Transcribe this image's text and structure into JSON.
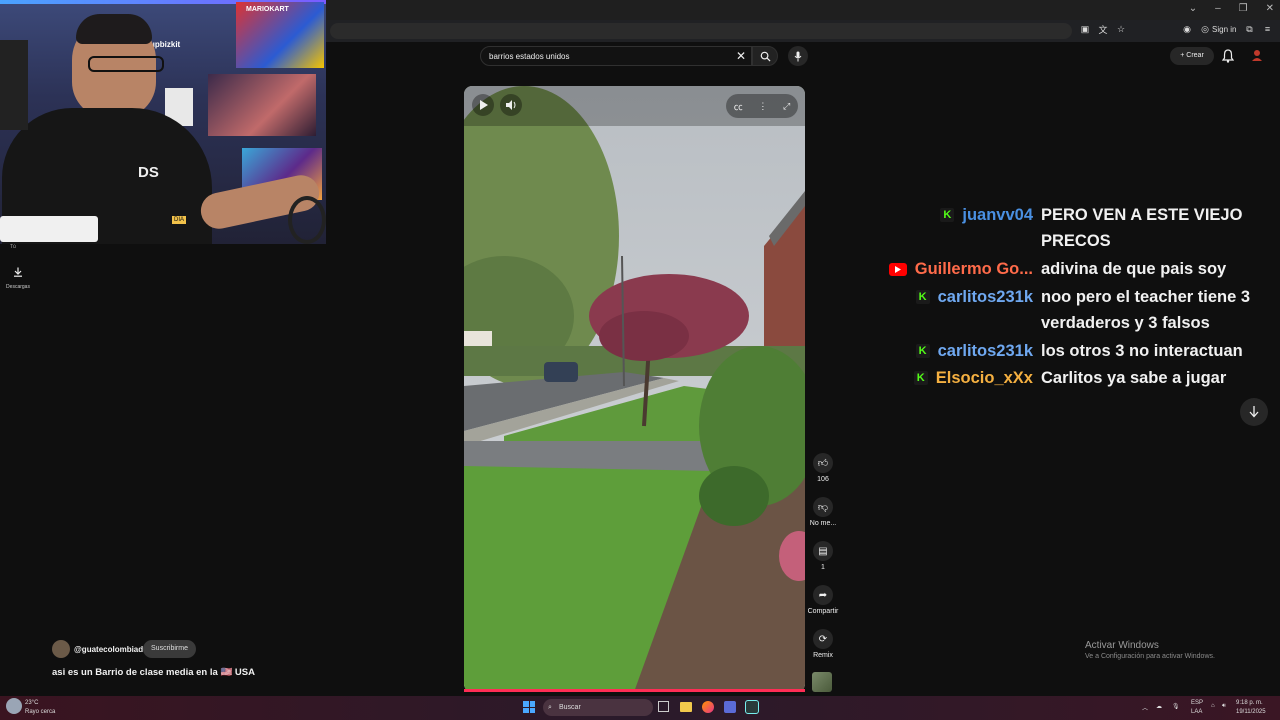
{
  "browser": {
    "tabbar_controls": [
      "⌄",
      "–",
      "❐",
      "✕"
    ],
    "sign_in_label": "Sign in"
  },
  "youtube_header": {
    "search_value": "barrios estados unidos",
    "create_label": "Crear"
  },
  "sidebar": {
    "partial_label": "Tú",
    "downloads_label": "Descargas"
  },
  "webcam": {
    "poster_text": "MARIOKART",
    "channel_handle_partial": "upbizkit",
    "shirt_logo": "DS",
    "sign_partial": "DIA"
  },
  "actions": {
    "like_count": "106",
    "dislike_label": "No me...",
    "comments_count": "1",
    "share_label": "Compartir",
    "remix_label": "Remix"
  },
  "chat": {
    "messages": [
      {
        "platform": "kick",
        "user": "juanvv04",
        "user_color": "#4a90e2",
        "text": "PERO VEN A ESTE VIEJO PRECOS"
      },
      {
        "platform": "youtube",
        "user": "Guillermo Go...",
        "user_color": "#ff6b4a",
        "text": "adivina de que pais soy"
      },
      {
        "platform": "kick",
        "user": "carlitos231k",
        "user_color": "#6fa8f0",
        "text": "noo pero el teacher tiene 3 verdaderos y 3 falsos"
      },
      {
        "platform": "kick",
        "user": "carlitos231k",
        "user_color": "#6fa8f0",
        "text": "los otros 3 no interactuan"
      },
      {
        "platform": "kick",
        "user": "Elsocio_xXx",
        "user_color": "#f5b041",
        "text": "Carlitos ya sabe a jugar"
      }
    ]
  },
  "channel": {
    "name": "@guatecolombiad",
    "subscribe_label": "Suscribirme",
    "video_title": "asi es un Barrio de clase media en la 🇺🇸 USA"
  },
  "windows_activation": {
    "title": "Activar Windows",
    "subtitle": "Ve a Configuración para activar Windows."
  },
  "taskbar": {
    "weather_temp": "23°C",
    "weather_desc": "Rayo cerca",
    "search_label": "Buscar",
    "lang_top": "ESP",
    "lang_bottom": "LAA",
    "time": "9:18 p. m.",
    "date": "19/11/2025"
  },
  "colors": {
    "kick_green": "#53fc18",
    "youtube_red": "#ff0000",
    "progress_red": "#ff2d55"
  }
}
